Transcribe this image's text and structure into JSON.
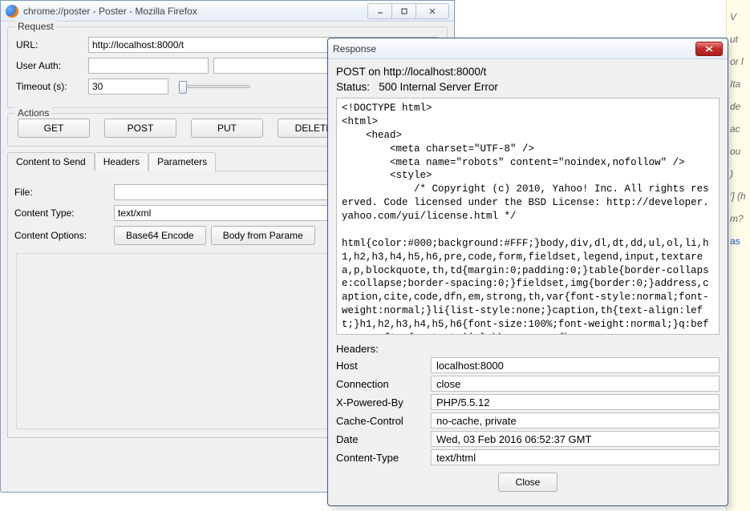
{
  "poster_window": {
    "title": "chrome://poster - Poster - Mozilla Firefox",
    "request": {
      "legend": "Request",
      "url_label": "URL:",
      "url_value": "http://localhost:8000/t",
      "userauth_label": "User Auth:",
      "userauth_value": "",
      "timeout_label": "Timeout (s):",
      "timeout_value": "30"
    },
    "actions": {
      "legend": "Actions",
      "buttons": [
        "GET",
        "POST",
        "PUT",
        "DELETE"
      ]
    },
    "tabs": [
      "Content to Send",
      "Headers",
      "Parameters"
    ],
    "content": {
      "file_label": "File:",
      "file_value": "",
      "ctype_label": "Content Type:",
      "ctype_value": "text/xml",
      "copts_label": "Content Options:",
      "base64_btn": "Base64 Encode",
      "bodyparam_btn": "Body from Parame"
    }
  },
  "response_dialog": {
    "title": "Response",
    "summary_line1": "POST on http://localhost:8000/t",
    "summary_line2": "Status:   500 Internal Server Error",
    "body_html": "<!DOCTYPE html>\n<html>\n    <head>\n        <meta charset=\"UTF-8\" />\n        <meta name=\"robots\" content=\"noindex,nofollow\" />\n        <style>\n            /* Copyright (c) 2010, Yahoo! Inc. All rights reserved. Code licensed under the BSD License: http://developer.yahoo.com/yui/license.html */\n\nhtml{color:#000;background:#FFF;}body,div,dl,dt,dd,ul,ol,li,h1,h2,h3,h4,h5,h6,pre,code,form,fieldset,legend,input,textarea,p,blockquote,th,td{margin:0;padding:0;}table{border-collapse:collapse;border-spacing:0;}fieldset,img{border:0;}address,caption,cite,code,dfn,em,strong,th,var{font-style:normal;font-weight:normal;}li{list-style:none;}caption,th{text-align:left;}h1,h2,h3,h4,h5,h6{font-size:100%;font-weight:normal;}q:before,q:after{content:'';}abbr,acronym{b",
    "headers_label": "Headers:",
    "headers": [
      {
        "name": "Host",
        "value": "localhost:8000"
      },
      {
        "name": "Connection",
        "value": "close"
      },
      {
        "name": "X-Powered-By",
        "value": "PHP/5.5.12"
      },
      {
        "name": "Cache-Control",
        "value": "no-cache, private"
      },
      {
        "name": "Date",
        "value": "Wed, 03 Feb 2016 06:52:37 GMT"
      },
      {
        "name": "Content-Type",
        "value": "text/html"
      }
    ],
    "close_btn": "Close"
  },
  "bg_fragments": [
    "V",
    "ut",
    "or l",
    "Ita",
    "de",
    "ac",
    "ou",
    ")",
    "'] (h",
    "m?",
    "as"
  ]
}
